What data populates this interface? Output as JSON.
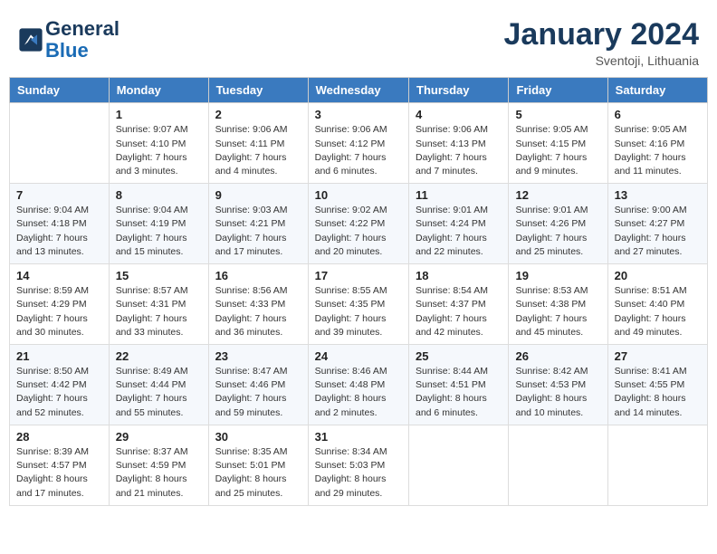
{
  "header": {
    "logo_line1": "General",
    "logo_line2": "Blue",
    "month": "January 2024",
    "location": "Sventoji, Lithuania"
  },
  "columns": [
    "Sunday",
    "Monday",
    "Tuesday",
    "Wednesday",
    "Thursday",
    "Friday",
    "Saturday"
  ],
  "weeks": [
    [
      {
        "day": "",
        "info": ""
      },
      {
        "day": "1",
        "info": "Sunrise: 9:07 AM\nSunset: 4:10 PM\nDaylight: 7 hours\nand 3 minutes."
      },
      {
        "day": "2",
        "info": "Sunrise: 9:06 AM\nSunset: 4:11 PM\nDaylight: 7 hours\nand 4 minutes."
      },
      {
        "day": "3",
        "info": "Sunrise: 9:06 AM\nSunset: 4:12 PM\nDaylight: 7 hours\nand 6 minutes."
      },
      {
        "day": "4",
        "info": "Sunrise: 9:06 AM\nSunset: 4:13 PM\nDaylight: 7 hours\nand 7 minutes."
      },
      {
        "day": "5",
        "info": "Sunrise: 9:05 AM\nSunset: 4:15 PM\nDaylight: 7 hours\nand 9 minutes."
      },
      {
        "day": "6",
        "info": "Sunrise: 9:05 AM\nSunset: 4:16 PM\nDaylight: 7 hours\nand 11 minutes."
      }
    ],
    [
      {
        "day": "7",
        "info": "Sunrise: 9:04 AM\nSunset: 4:18 PM\nDaylight: 7 hours\nand 13 minutes."
      },
      {
        "day": "8",
        "info": "Sunrise: 9:04 AM\nSunset: 4:19 PM\nDaylight: 7 hours\nand 15 minutes."
      },
      {
        "day": "9",
        "info": "Sunrise: 9:03 AM\nSunset: 4:21 PM\nDaylight: 7 hours\nand 17 minutes."
      },
      {
        "day": "10",
        "info": "Sunrise: 9:02 AM\nSunset: 4:22 PM\nDaylight: 7 hours\nand 20 minutes."
      },
      {
        "day": "11",
        "info": "Sunrise: 9:01 AM\nSunset: 4:24 PM\nDaylight: 7 hours\nand 22 minutes."
      },
      {
        "day": "12",
        "info": "Sunrise: 9:01 AM\nSunset: 4:26 PM\nDaylight: 7 hours\nand 25 minutes."
      },
      {
        "day": "13",
        "info": "Sunrise: 9:00 AM\nSunset: 4:27 PM\nDaylight: 7 hours\nand 27 minutes."
      }
    ],
    [
      {
        "day": "14",
        "info": "Sunrise: 8:59 AM\nSunset: 4:29 PM\nDaylight: 7 hours\nand 30 minutes."
      },
      {
        "day": "15",
        "info": "Sunrise: 8:57 AM\nSunset: 4:31 PM\nDaylight: 7 hours\nand 33 minutes."
      },
      {
        "day": "16",
        "info": "Sunrise: 8:56 AM\nSunset: 4:33 PM\nDaylight: 7 hours\nand 36 minutes."
      },
      {
        "day": "17",
        "info": "Sunrise: 8:55 AM\nSunset: 4:35 PM\nDaylight: 7 hours\nand 39 minutes."
      },
      {
        "day": "18",
        "info": "Sunrise: 8:54 AM\nSunset: 4:37 PM\nDaylight: 7 hours\nand 42 minutes."
      },
      {
        "day": "19",
        "info": "Sunrise: 8:53 AM\nSunset: 4:38 PM\nDaylight: 7 hours\nand 45 minutes."
      },
      {
        "day": "20",
        "info": "Sunrise: 8:51 AM\nSunset: 4:40 PM\nDaylight: 7 hours\nand 49 minutes."
      }
    ],
    [
      {
        "day": "21",
        "info": "Sunrise: 8:50 AM\nSunset: 4:42 PM\nDaylight: 7 hours\nand 52 minutes."
      },
      {
        "day": "22",
        "info": "Sunrise: 8:49 AM\nSunset: 4:44 PM\nDaylight: 7 hours\nand 55 minutes."
      },
      {
        "day": "23",
        "info": "Sunrise: 8:47 AM\nSunset: 4:46 PM\nDaylight: 7 hours\nand 59 minutes."
      },
      {
        "day": "24",
        "info": "Sunrise: 8:46 AM\nSunset: 4:48 PM\nDaylight: 8 hours\nand 2 minutes."
      },
      {
        "day": "25",
        "info": "Sunrise: 8:44 AM\nSunset: 4:51 PM\nDaylight: 8 hours\nand 6 minutes."
      },
      {
        "day": "26",
        "info": "Sunrise: 8:42 AM\nSunset: 4:53 PM\nDaylight: 8 hours\nand 10 minutes."
      },
      {
        "day": "27",
        "info": "Sunrise: 8:41 AM\nSunset: 4:55 PM\nDaylight: 8 hours\nand 14 minutes."
      }
    ],
    [
      {
        "day": "28",
        "info": "Sunrise: 8:39 AM\nSunset: 4:57 PM\nDaylight: 8 hours\nand 17 minutes."
      },
      {
        "day": "29",
        "info": "Sunrise: 8:37 AM\nSunset: 4:59 PM\nDaylight: 8 hours\nand 21 minutes."
      },
      {
        "day": "30",
        "info": "Sunrise: 8:35 AM\nSunset: 5:01 PM\nDaylight: 8 hours\nand 25 minutes."
      },
      {
        "day": "31",
        "info": "Sunrise: 8:34 AM\nSunset: 5:03 PM\nDaylight: 8 hours\nand 29 minutes."
      },
      {
        "day": "",
        "info": ""
      },
      {
        "day": "",
        "info": ""
      },
      {
        "day": "",
        "info": ""
      }
    ]
  ]
}
